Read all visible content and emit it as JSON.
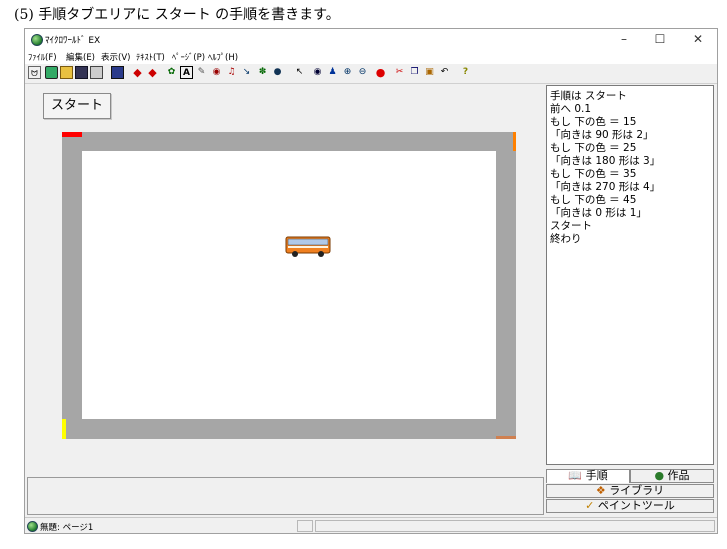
{
  "caption": "(5) 手順タブエリアに スタート の手順を書きます。",
  "window": {
    "title": "ﾏｲｸﾛﾜｰﾙﾄﾞ EX",
    "minimize": "–",
    "maximize": "☐",
    "close": "✕"
  },
  "menu": [
    "ﾌｧｲﾙ(F)",
    "編集(E)",
    "表示(V)",
    "ﾃｷｽﾄ(T)",
    "ﾍﾟｰｼﾞ(P)",
    "ﾍﾙﾌﾟ(H)"
  ],
  "toolbar": {
    "icons": [
      "pointer-icon",
      "new-icon",
      "open-icon",
      "save-icon",
      "print-icon",
      "list-icon",
      "left-arrow-icon",
      "right-arrow-icon",
      "character-icon",
      "text-icon",
      "pen-icon",
      "eye-icon",
      "music-icon",
      "brush-icon",
      "picture-icon",
      "globe-icon",
      "cursor-icon",
      "view-icon",
      "person-icon",
      "zoom-in-icon",
      "zoom-out-icon",
      "stop-icon",
      "scissors-icon",
      "copy-icon",
      "paste-icon",
      "undo-icon",
      "help-icon"
    ],
    "help_label": "?"
  },
  "stage": {
    "start_button": "スタート"
  },
  "steps": [
    "手順は スタート",
    "前へ 0.1",
    "もし 下の色 ＝ 15",
    "「向きは 90 形は 2」",
    "もし 下の色 ＝ 25",
    "「向きは 180 形は 3」",
    "もし 下の色 ＝ 35",
    "「向きは 270 形は 4」",
    "もし 下の色 ＝ 45",
    "「向きは 0 形は 1」",
    "スタート",
    "終わり"
  ],
  "tabs": {
    "steps": "手順",
    "works": "作品",
    "library": "ライブラリ",
    "paint": "ペイントツール"
  },
  "status": {
    "title": "無題: ページ1"
  },
  "colors": {
    "track": "#a6a6a6",
    "red_marker": "#ff0000",
    "orange_marker": "#ff8000",
    "yellow_marker": "#ffff00",
    "brown_marker": "#d08050",
    "bus_body": "#f08020"
  }
}
